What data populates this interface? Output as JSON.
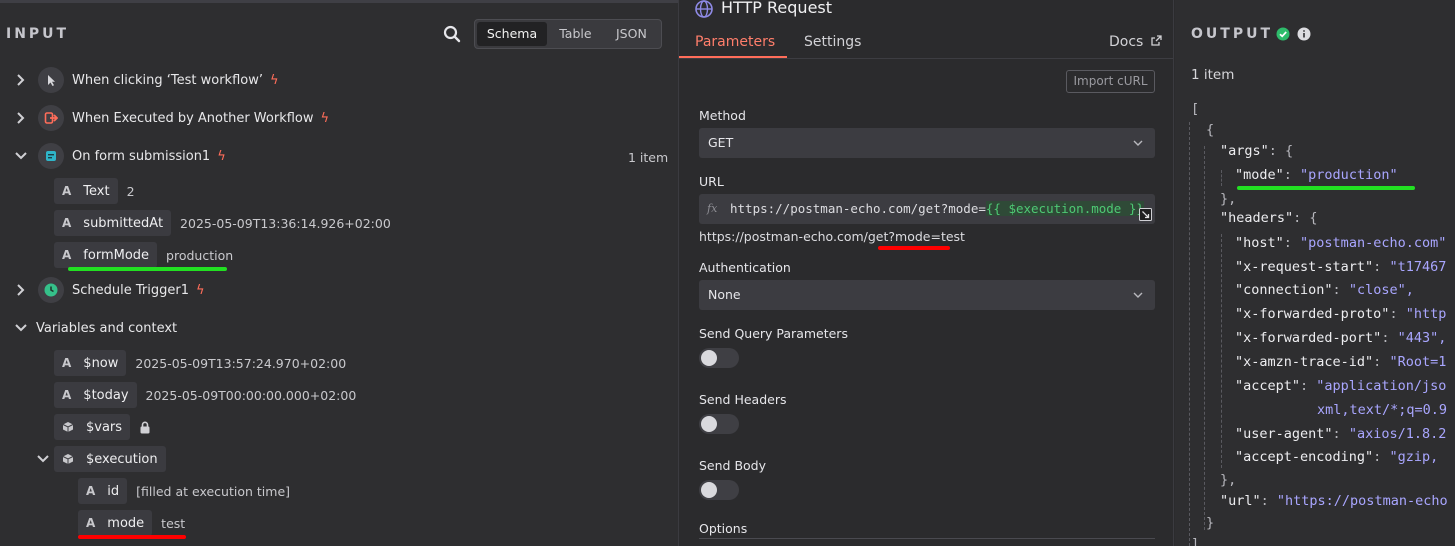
{
  "input": {
    "title": "INPUT",
    "view_tabs": [
      "Schema",
      "Table",
      "JSON"
    ],
    "active_view": "Schema",
    "nodes": [
      {
        "label": "When clicking ‘Test workflow’",
        "icon": "cursor-icon"
      },
      {
        "label": "When Executed by Another Workflow",
        "icon": "sign-in-icon"
      },
      {
        "label": "On form submission1",
        "icon": "form-icon",
        "count": "1 item"
      },
      {
        "label": "Schedule Trigger1",
        "icon": "clock-icon"
      }
    ],
    "form_fields": [
      {
        "type": "A",
        "key": "Text",
        "value": "2"
      },
      {
        "type": "A",
        "key": "submittedAt",
        "value": "2025-05-09T13:36:14.926+02:00"
      },
      {
        "type": "A",
        "key": "formMode",
        "value": "production"
      }
    ],
    "variables_label": "Variables and context",
    "variables": [
      {
        "type": "A",
        "key": "$now",
        "value": "2025-05-09T13:57:24.970+02:00"
      },
      {
        "type": "A",
        "key": "$today",
        "value": "2025-05-09T00:00:00.000+02:00"
      },
      {
        "type": "cube",
        "key": "$vars",
        "value": ""
      },
      {
        "type": "cube",
        "key": "$execution",
        "value": ""
      }
    ],
    "execution_fields": [
      {
        "type": "A",
        "key": "id",
        "value": "[filled at execution time]"
      },
      {
        "type": "A",
        "key": "mode",
        "value": "test"
      }
    ]
  },
  "params": {
    "node_title": "HTTP Request",
    "tabs": [
      "Parameters",
      "Settings"
    ],
    "docs_label": "Docs",
    "import_curl": "Import cURL",
    "method_label": "Method",
    "method_value": "GET",
    "url_label": "URL",
    "url_fx": "fx",
    "url_prefix": "https://postman-echo.com/get?mode=",
    "url_expression": "{{ $execution.mode }}",
    "url_resolved": "https://postman-echo.com/get?mode=test",
    "auth_label": "Authentication",
    "auth_value": "None",
    "send_query_label": "Send Query Parameters",
    "send_headers_label": "Send Headers",
    "send_body_label": "Send Body",
    "options_label": "Options"
  },
  "output": {
    "title": "OUTPUT",
    "count": "1 item",
    "json": {
      "open_bracket": "[",
      "open_brace": "{",
      "args_key": "\"args\"",
      "args_open": ": {",
      "mode_key": "\"mode\"",
      "mode_value": "\"production\"",
      "args_close": "},",
      "headers_key": "\"headers\"",
      "headers_open": ": {",
      "headers": [
        {
          "key": "\"host\"",
          "value": "\"postman-echo.com\""
        },
        {
          "key": "\"x-request-start\"",
          "value": "\"t17467"
        },
        {
          "key": "\"connection\"",
          "value": "\"close\","
        },
        {
          "key": "\"x-forwarded-proto\"",
          "value": "\"http"
        },
        {
          "key": "\"x-forwarded-port\"",
          "value": "\"443\","
        },
        {
          "key": "\"x-amzn-trace-id\"",
          "value": "\"Root=1"
        },
        {
          "key": "\"accept\"",
          "value": "\"application/jso"
        },
        {
          "key": "",
          "value": "xml,text/*;q=0.9"
        },
        {
          "key": "\"user-agent\"",
          "value": "\"axios/1.8.2"
        },
        {
          "key": "\"accept-encoding\"",
          "value": "\"gzip,"
        }
      ],
      "headers_close": "},",
      "url_key": "\"url\"",
      "url_value": "\"https://postman-echo",
      "close_brace": "}",
      "close_bracket": "]"
    }
  },
  "colors": {
    "accent": "#ff6d5a",
    "highlight_green": "#22e022",
    "highlight_red": "#ff0000",
    "expression_green": "#4ec974",
    "json_value": "#a9a6ff"
  }
}
